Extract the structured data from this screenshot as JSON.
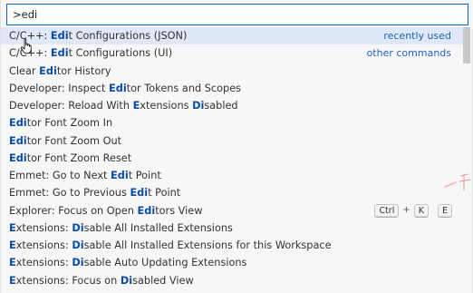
{
  "search": {
    "value": ">edi"
  },
  "rows": [
    {
      "segments": [
        {
          "t": "C/C++: ",
          "h": false
        },
        {
          "t": "Edi",
          "h": true
        },
        {
          "t": "t Configurations (JSON)",
          "h": false
        }
      ],
      "meta": "recently used"
    },
    {
      "segments": [
        {
          "t": "C/C++: ",
          "h": false
        },
        {
          "t": "Edi",
          "h": true
        },
        {
          "t": "t Configurations (UI)",
          "h": false
        }
      ],
      "meta": "other commands"
    },
    {
      "segments": [
        {
          "t": "Clear ",
          "h": false
        },
        {
          "t": "Edi",
          "h": true
        },
        {
          "t": "tor History",
          "h": false
        }
      ]
    },
    {
      "segments": [
        {
          "t": "Developer: Inspect ",
          "h": false
        },
        {
          "t": "Edi",
          "h": true
        },
        {
          "t": "tor Tokens and Scopes",
          "h": false
        }
      ]
    },
    {
      "segments": [
        {
          "t": "Developer: Reload With ",
          "h": false
        },
        {
          "t": "E",
          "h": true
        },
        {
          "t": "xtensions ",
          "h": false
        },
        {
          "t": "Di",
          "h": true
        },
        {
          "t": "sabled",
          "h": false
        }
      ]
    },
    {
      "segments": [
        {
          "t": "Edi",
          "h": true
        },
        {
          "t": "tor Font Zoom In",
          "h": false
        }
      ]
    },
    {
      "segments": [
        {
          "t": "Edi",
          "h": true
        },
        {
          "t": "tor Font Zoom Out",
          "h": false
        }
      ]
    },
    {
      "segments": [
        {
          "t": "Edi",
          "h": true
        },
        {
          "t": "tor Font Zoom Reset",
          "h": false
        }
      ]
    },
    {
      "segments": [
        {
          "t": "Emmet: Go to Next ",
          "h": false
        },
        {
          "t": "Edi",
          "h": true
        },
        {
          "t": "t Point",
          "h": false
        }
      ]
    },
    {
      "segments": [
        {
          "t": "Emmet: Go to Previous ",
          "h": false
        },
        {
          "t": "Edi",
          "h": true
        },
        {
          "t": "t Point",
          "h": false
        }
      ]
    },
    {
      "segments": [
        {
          "t": "Explorer: Focus on Open ",
          "h": false
        },
        {
          "t": "Edi",
          "h": true
        },
        {
          "t": "tors View",
          "h": false
        }
      ],
      "keys": [
        "Ctrl",
        "K",
        "E"
      ]
    },
    {
      "segments": [
        {
          "t": "E",
          "h": true
        },
        {
          "t": "xtensions: ",
          "h": false
        },
        {
          "t": "Di",
          "h": true
        },
        {
          "t": "sable All Installed Extensions",
          "h": false
        }
      ]
    },
    {
      "segments": [
        {
          "t": "E",
          "h": true
        },
        {
          "t": "xtensions: ",
          "h": false
        },
        {
          "t": "Di",
          "h": true
        },
        {
          "t": "sable All Installed Extensions for this Workspace",
          "h": false
        }
      ]
    },
    {
      "segments": [
        {
          "t": "E",
          "h": true
        },
        {
          "t": "xtensions: ",
          "h": false
        },
        {
          "t": "Di",
          "h": true
        },
        {
          "t": "sable Auto Updating Extensions",
          "h": false
        }
      ]
    },
    {
      "segments": [
        {
          "t": "E",
          "h": true
        },
        {
          "t": "xtensions: Focus on ",
          "h": false
        },
        {
          "t": "Di",
          "h": true
        },
        {
          "t": "sabled View",
          "h": false
        }
      ]
    }
  ],
  "keys_separator": "+",
  "colors": {
    "accent": "#0a64c6",
    "highlight": "#0a4aa8",
    "selected_row": "#dfe8f6",
    "meta_text": "#1f62c1"
  }
}
